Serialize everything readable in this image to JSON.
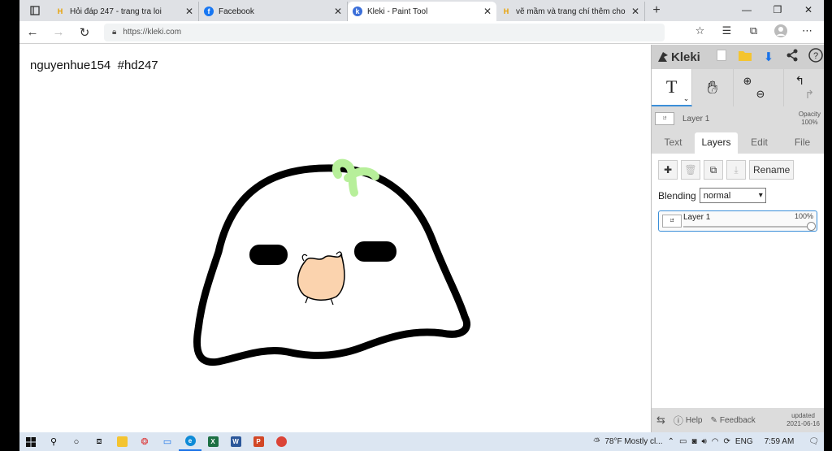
{
  "browser": {
    "tabs": [
      {
        "title": "Hỏi đáp 247 - trang tra loi",
        "favicon": "H",
        "color": "#e8a000"
      },
      {
        "title": "Facebook",
        "favicon": "f",
        "color": "#1877f2"
      },
      {
        "title": "Kleki - Paint Tool",
        "favicon": "k",
        "color": "#3b6fd9"
      },
      {
        "title": "vẽ mầm và trang chí thêm cho m",
        "favicon": "H",
        "color": "#e8a000"
      }
    ],
    "url": "https://kleki.com"
  },
  "canvas": {
    "text": "nguyenhue154  #hd247"
  },
  "panel": {
    "logo": "Kleki",
    "layer_name": "Layer 1",
    "opacity_label": "Opacity",
    "opacity_value": "100%",
    "tabs": [
      "Text",
      "Layers",
      "Edit",
      "File"
    ],
    "rename_label": "Rename",
    "blending_label": "Blending",
    "blending_value": "normal",
    "layer_item": {
      "name": "Layer 1",
      "opacity": "100%"
    },
    "footer": {
      "help": "Help",
      "feedback": "Feedback",
      "updated_label": "updated",
      "updated_date": "2021-06-16"
    }
  },
  "taskbar": {
    "weather": "78°F  Mostly cl...",
    "lang": "ENG",
    "time": "7:59 AM"
  }
}
